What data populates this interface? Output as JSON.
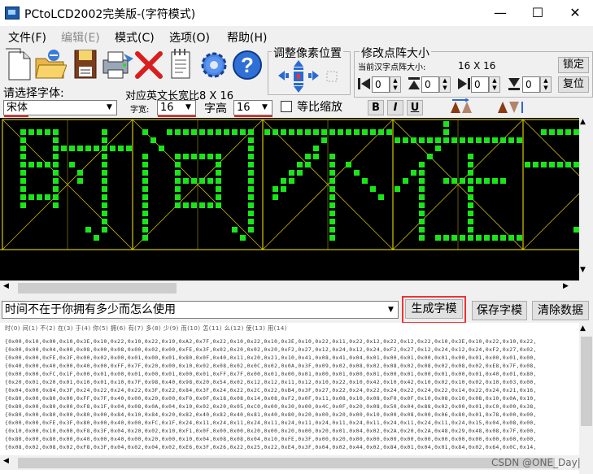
{
  "window": {
    "title": "PCtoLCD2002完美版-(字符模式)",
    "minimize": "—",
    "maximize": "☐",
    "close": "✕"
  },
  "menu": [
    {
      "label": "文件(F)",
      "enabled": true
    },
    {
      "label": "编辑(E)",
      "enabled": false
    },
    {
      "label": "模式(C)",
      "enabled": true
    },
    {
      "label": "选项(O)",
      "enabled": true
    },
    {
      "label": "帮助(H)",
      "enabled": true
    }
  ],
  "toolbar": {
    "icons": [
      "new-file-icon",
      "open-folder-icon",
      "save-disk-icon",
      "printer-icon",
      "delete-x-icon",
      "notepad-icon",
      "settings-gear-icon",
      "help-icon"
    ],
    "help_glyph": "?",
    "delete_glyph": "✕"
  },
  "pixel_adjust": {
    "label": "调整像素位置"
  },
  "matrix_size": {
    "label": "修改点阵大小",
    "current_label": "当前汉字点阵大小:",
    "current_value": "16 X 16",
    "lock_button": "锁定",
    "reset_button": "复位",
    "spins": [
      "0",
      "0",
      "0",
      "0"
    ]
  },
  "font": {
    "choose_label": "请选择字体:",
    "font_name": "宋体",
    "en_width_label": "对应英文长宽比8 X 16",
    "width_label": "字宽:",
    "width_value": "16",
    "height_label": "字高",
    "height_value": "16",
    "proportional_label": "等比缩放",
    "bold": "B",
    "italic": "I",
    "underline": "U"
  },
  "input": {
    "text": "时间不在于你拥有多少而怎么使用",
    "generate_button": "生成字模",
    "save_button": "保存字模",
    "clear_button": "清除数据"
  },
  "output": {
    "index_line": "时(0) 间(1) 不(2) 在(3) 于(4) 你(5) 拥(6) 有(7) 多(8) 少(9) 而(10) 怎(11) 么(12) 使(13) 用(14)",
    "hex_lines": [
      "{0x00,0x10,0x00,0x10,0x3E,0x10,0x22,0x10,0x22,0x10,0xA2,0x7F,0x22,0x10,0x22,0x10,0x3E,0x10,0x22,0x11,0x22,0x12,0x22,0x12,0x22,0x10,0x3E,0x10,0x22,0x10,0x22,",
      "{0x00,0x00,0x04,0x00,0x08,0x00,0x08,0x00,0x02,0x00,0xFE,0x3F,0x02,0x20,0x02,0x20,0xF2,0x27,0x12,0x24,0x12,0x24,0xF2,0x27,0x12,0x24,0x12,0x24,0xF2,0x27,0x02,",
      "{0x00,0x00,0xFE,0x3F,0x00,0x02,0x00,0x01,0x00,0x01,0x80,0x0F,0x40,0x11,0x20,0x21,0x10,0x41,0x08,0x41,0x04,0x01,0x00,0x01,0x00,0x01,0x00,0x01,0x00,0x01,0x00,",
      "{0x40,0x00,0x40,0x00,0x40,0x00,0xFF,0x7F,0x20,0x00,0x10,0x02,0x08,0x02,0x0C,0x02,0x0A,0x3F,0x09,0x02,0x08,0x02,0x08,0x02,0x08,0x02,0x08,0x02,0xE8,0x7F,0x08,",
      "{0x00,0x00,0xFC,0x1F,0x00,0x01,0x00,0x01,0x00,0x01,0x00,0x01,0xFF,0x7F,0x00,0x01,0x00,0x01,0x00,0x01,0x00,0x01,0x00,0x01,0x00,0x01,0x00,0x01,0x40,0x01,0x80,",
      "{0x20,0x01,0x20,0x01,0x10,0x01,0x10,0x7F,0x98,0x40,0x98,0x20,0x54,0x02,0x12,0x12,0x11,0x12,0x10,0x22,0x10,0x42,0x10,0x42,0x10,0x02,0x10,0x02,0x10,0x03,0x00,",
      "{0x04,0x00,0x84,0x3F,0x24,0x22,0x24,0x22,0x3F,0x22,0x84,0x3F,0x24,0x22,0x2C,0x22,0xB4,0x3F,0x27,0x22,0x24,0x22,0x24,0x22,0x24,0x22,0x14,0x22,0x24,0x21,0x16,",
      "{0x80,0x00,0x80,0x00,0xFF,0x7F,0x40,0x00,0x20,0x00,0xF0,0x0F,0x18,0x08,0x14,0x08,0xF2,0x0F,0x11,0x08,0x10,0x08,0xF0,0x0F,0x10,0x08,0x10,0x08,0x10,0x0A,0x10,",
      "{0x80,0x00,0x80,0x00,0xF8,0x1F,0x04,0x08,0x0A,0x04,0x10,0x02,0x20,0x05,0xC0,0x00,0x30,0x00,0x4C,0x0F,0x20,0x08,0x50,0x04,0x88,0x02,0x00,0x01,0xC0,0x00,0x38,",
      "{0x80,0x00,0x80,0x00,0x80,0x00,0x84,0x10,0x84,0x20,0x82,0x40,0x82,0x40,0x81,0x40,0x80,0x20,0x00,0x20,0x00,0x10,0x00,0x08,0x00,0x06,0x80,0x01,0x78,0x00,0x00,",
      "{0x00,0x00,0xFE,0x3F,0x80,0x00,0x40,0x00,0xFC,0x1F,0x24,0x11,0x24,0x11,0x24,0x11,0x24,0x11,0x24,0x11,0x24,0x11,0x24,0x11,0x24,0x11,0x24,0x15,0x04,0x08,0x00,",
      "{0x10,0x00,0x10,0x00,0xF8,0x3F,0x04,0x20,0x02,0x10,0xF1,0x0F,0x00,0x00,0x20,0x00,0x20,0x00,0x20,0x01,0x04,0x02,0x2A,0x20,0x2A,0x48,0x29,0x48,0x08,0x7F,0x00,",
      "{0x80,0x00,0x80,0x00,0x40,0x00,0x40,0x00,0x20,0x00,0x10,0x04,0x08,0x08,0x04,0x10,0xFE,0x3F,0x00,0x20,0x00,0x00,0x00,0x00,0x00,0x00,0x00,0x00,0x00,0x00,0x00,",
      "{0x08,0x02,0x08,0x02,0xF8,0x3F,0x04,0x02,0x04,0x02,0xE6,0x3F,0x26,0x22,0x25,0x22,0xE4,0x3F,0x04,0x02,0x44,0x02,0x84,0x01,0x04,0x01,0x84,0x02,0x64,0x0C,0x14,"
    ]
  },
  "watermark": "CSDN @ONE_Day|"
}
